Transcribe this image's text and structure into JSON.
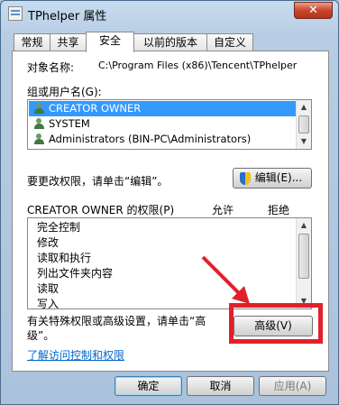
{
  "window": {
    "title": "TPhelper 属性",
    "close_label": "✕"
  },
  "tabs": [
    {
      "label": "常规"
    },
    {
      "label": "共享"
    },
    {
      "label": "安全"
    },
    {
      "label": "以前的版本"
    },
    {
      "label": "自定义"
    }
  ],
  "active_tab": "安全",
  "object": {
    "label": "对象名称:",
    "value": "C:\\Program Files (x86)\\Tencent\\TPhelper"
  },
  "groups": {
    "label": "组或用户名(G):",
    "items": [
      {
        "label": "CREATOR OWNER",
        "selected": true
      },
      {
        "label": "SYSTEM",
        "selected": false
      },
      {
        "label": "Administrators (BIN-PC\\Administrators)",
        "selected": false
      }
    ]
  },
  "change": {
    "label": "要更改权限，请单击“编辑”。",
    "edit_button": "编辑(E)..."
  },
  "permissions": {
    "title": "CREATOR OWNER 的权限(P)",
    "allow_header": "允许",
    "deny_header": "拒绝",
    "items": [
      {
        "label": "完全控制"
      },
      {
        "label": "修改"
      },
      {
        "label": "读取和执行"
      },
      {
        "label": "列出文件夹内容"
      },
      {
        "label": "读取"
      },
      {
        "label": "写入"
      }
    ]
  },
  "advanced": {
    "note": "有关特殊权限或高级设置，请单击“高级”。",
    "button": "高级(V)"
  },
  "link": {
    "label": "了解访问控制和权限"
  },
  "footer": {
    "ok": "确定",
    "cancel": "取消",
    "apply": "应用(A)"
  },
  "colors": {
    "selection": "#3399ff",
    "highlight": "#e2202a",
    "link": "#0066cc"
  }
}
